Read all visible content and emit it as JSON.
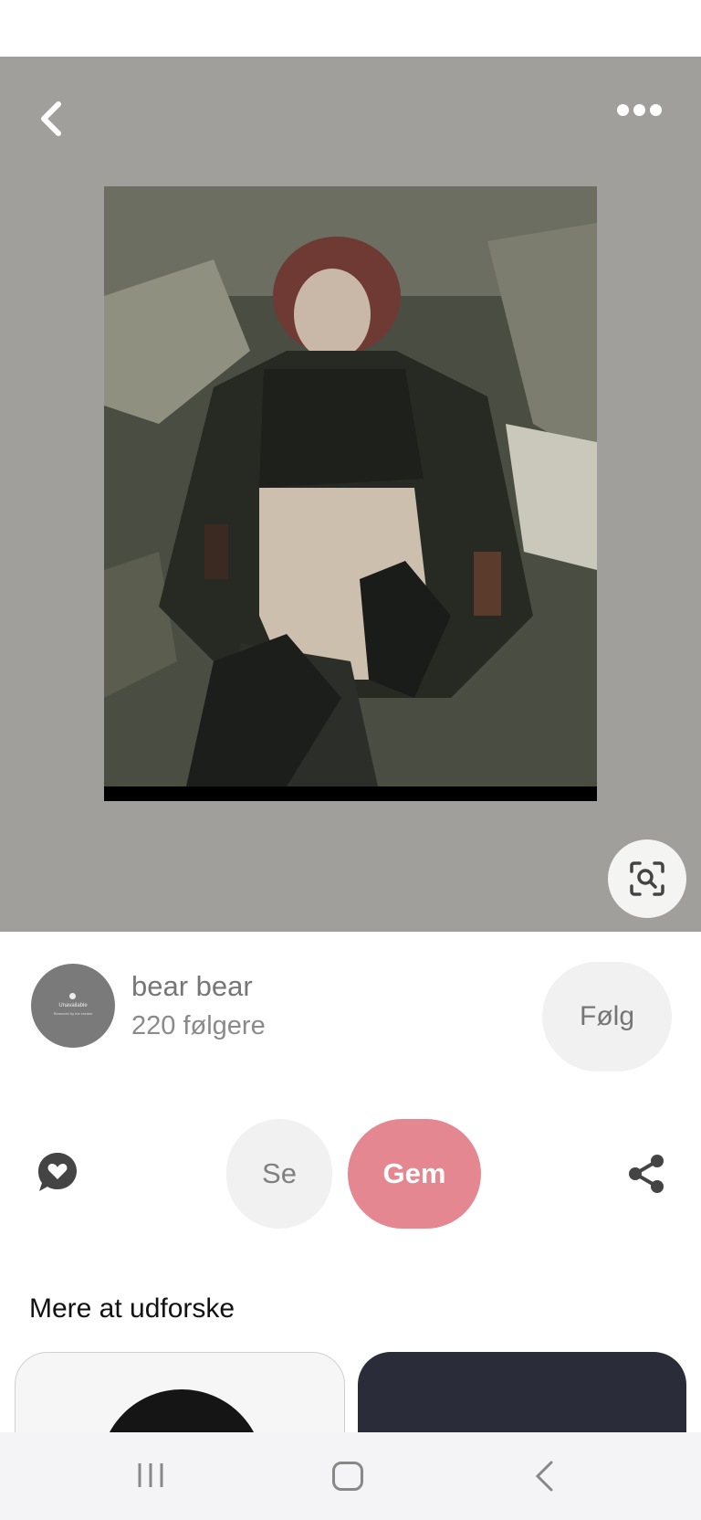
{
  "pin": {
    "image_alt": "Pin image",
    "icons": {
      "back": "chevron-left-icon",
      "more": "more-horizontal-icon",
      "lens": "visual-search-icon"
    }
  },
  "creator": {
    "avatar_line1": "Unavailable",
    "avatar_line2": "Removed by the creator",
    "name": "bear bear",
    "followers": "220 følgere",
    "follow_label": "Følg"
  },
  "actions": {
    "see_label": "Se",
    "save_label": "Gem",
    "icons": {
      "comment": "heart-speech-bubble-icon",
      "share": "share-icon"
    },
    "save_color": "#e48791"
  },
  "explore": {
    "title": "Mere at udforske"
  },
  "colors": {
    "hero_bg": "#a19f9b"
  }
}
